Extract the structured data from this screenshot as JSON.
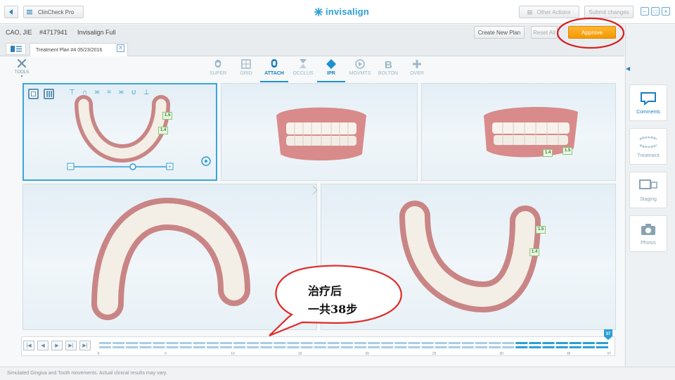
{
  "titlebar": {
    "app_menu_label": "ClinCheck Pro",
    "brand": "invisalign",
    "other_actions_label": "Other Actions",
    "submit_changes_label": "Submit changes"
  },
  "patient": {
    "name": "CAO, JIE",
    "id": "#4717941",
    "product": "Invisalign Full"
  },
  "actions": {
    "create_new_plan": "Create New Plan",
    "reset_all": "Reset All",
    "approve": "Approve",
    "approve_color": "#f39a00"
  },
  "tab": {
    "label": "Treatment Plan #4 05/23/2016",
    "close": "X"
  },
  "toolbar": {
    "tools_label": "TOOLS",
    "items": [
      {
        "label": "SUPER",
        "icon": "superimpose-icon"
      },
      {
        "label": "GRID",
        "icon": "grid-icon"
      },
      {
        "label": "ATTACH",
        "icon": "attachment-icon",
        "active": true
      },
      {
        "label": "OCCLUS",
        "icon": "occlusion-icon"
      },
      {
        "label": "IPR",
        "icon": "ipr-icon",
        "active": true
      },
      {
        "label": "MOVMTS",
        "icon": "movements-icon"
      },
      {
        "label": "BOLTON",
        "icon": "bolton-icon"
      },
      {
        "label": "OVER",
        "icon": "overlay-icon"
      }
    ]
  },
  "ipr_tags": {
    "small_view_a": "1.5",
    "small_view_b": "1.4",
    "right_view_a": "1.4",
    "right_view_b": "1.5",
    "large_view_a": "1.5",
    "large_view_b": "1.4"
  },
  "right_panel": {
    "items": [
      {
        "label": "Comments",
        "icon": "comment-icon",
        "active": true
      },
      {
        "label": "Treatment",
        "icon": "teeth-icon"
      },
      {
        "label": "Staging",
        "icon": "staging-icon"
      },
      {
        "label": "Photos",
        "icon": "camera-icon"
      }
    ]
  },
  "timeline": {
    "current_stage": "37",
    "tick_labels": [
      "0",
      "5",
      "10",
      "15",
      "20",
      "25",
      "30",
      "35",
      "37"
    ],
    "total_stages": 38,
    "highlight_color": "#2b9fd7"
  },
  "annotation": {
    "line1": "治疗后",
    "line2": "一共38步"
  },
  "status": "Simulated Gingiva and Tooth movements. Actual clinical results may vary."
}
